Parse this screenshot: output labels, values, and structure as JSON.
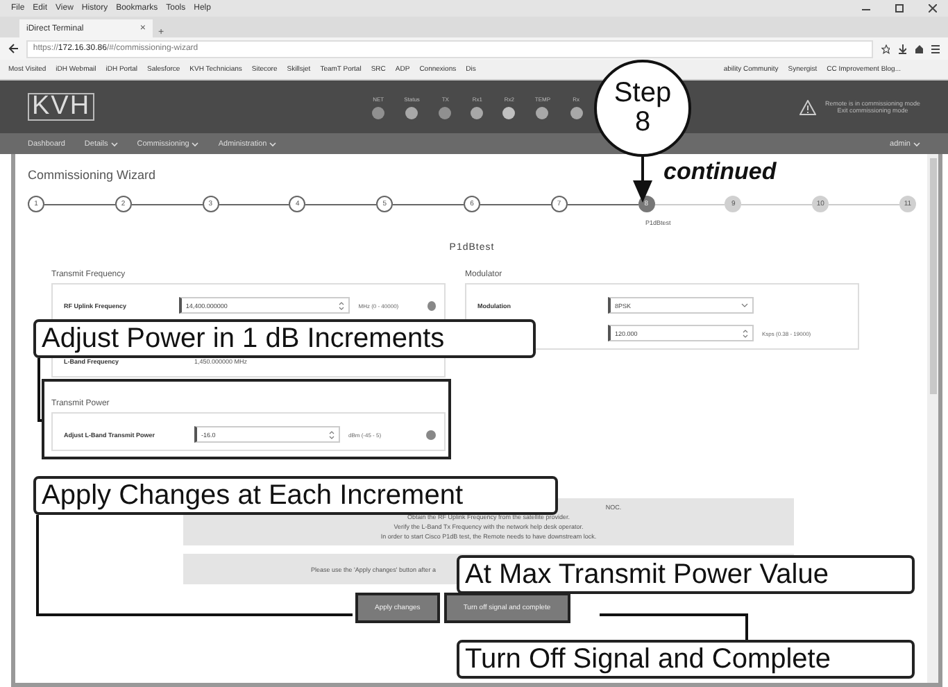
{
  "menu": [
    "File",
    "Edit",
    "View",
    "History",
    "Bookmarks",
    "Tools",
    "Help"
  ],
  "browser_tab": {
    "title": "iDirect Terminal",
    "close": "×",
    "new_tab": "+"
  },
  "address": {
    "prefix": "https://",
    "host": "172.16.30.86",
    "path": "/#/commissioning-wizard"
  },
  "bookmarks_left": [
    "Most Visited",
    "iDH Webmail",
    "iDH Portal",
    "Salesforce",
    "KVH Technicians",
    "Sitecore",
    "Skillsjet",
    "TeamT Portal",
    "SRC",
    "ADP",
    "Connexions",
    "Dis"
  ],
  "bookmarks_right": [
    "ability Community",
    "Synergist",
    "CC Improvement Blog..."
  ],
  "header": {
    "logo": "KVH",
    "indicators": [
      {
        "label": "NET",
        "color": "#909090"
      },
      {
        "label": "Status",
        "color": "#a8a8a8"
      },
      {
        "label": "TX",
        "color": "#909090"
      },
      {
        "label": "Rx1",
        "color": "#a8a8a8"
      },
      {
        "label": "Rx2",
        "color": "#c0c0c0"
      },
      {
        "label": "TEMP",
        "color": "#a8a8a8"
      },
      {
        "label": "Rx",
        "color": "#a8a8a8"
      }
    ],
    "warning": [
      "Remote is in commissioning mode",
      "Exit commissioning mode"
    ]
  },
  "nav": {
    "items": [
      {
        "label": "Dashboard",
        "dropdown": false
      },
      {
        "label": "Details",
        "dropdown": true
      },
      {
        "label": "Commissioning",
        "dropdown": true
      },
      {
        "label": "Administration",
        "dropdown": true
      }
    ],
    "user": "admin"
  },
  "wizard": {
    "title": "Commissioning Wizard",
    "steps": [
      {
        "number": "1",
        "done": true,
        "selected": false
      },
      {
        "number": "2",
        "done": true,
        "selected": false
      },
      {
        "number": "3",
        "done": true,
        "selected": false
      },
      {
        "number": "4",
        "done": true,
        "selected": false
      },
      {
        "number": "5",
        "done": true,
        "selected": false
      },
      {
        "number": "6",
        "done": true,
        "selected": false
      },
      {
        "number": "7",
        "done": true,
        "selected": false
      },
      {
        "number": "8",
        "done": false,
        "selected": true
      },
      {
        "number": "9",
        "done": false,
        "selected": false
      },
      {
        "number": "10",
        "done": false,
        "selected": false
      },
      {
        "number": "11",
        "done": false,
        "selected": false
      }
    ],
    "step_label": "P1dBtest"
  },
  "page_title": "P1dBtest",
  "transmit_frequency": {
    "title": "Transmit Frequency",
    "rows": [
      {
        "label": "RF Uplink Frequency",
        "value": "14,400.000000",
        "unit": "MHz (0 - 40000)"
      },
      {
        "label": "L-Band Frequency",
        "value": "1,450.000000 MHz"
      }
    ]
  },
  "modulator": {
    "title": "Modulator",
    "rows": [
      {
        "label": "Modulation",
        "value": "8PSK",
        "kind": "select"
      },
      {
        "value": "120.000",
        "unit": "Ksps (0.38 - 19000)",
        "kind": "number"
      }
    ]
  },
  "transmit_power": {
    "title": "Transmit Power",
    "label": "Adjust L-Band Transmit Power",
    "value": "-16.0",
    "unit": "dBm (-45 - 5)"
  },
  "notes": [
    "NOC.",
    "Obtain the RF Uplink Frequency from the satellite provider.",
    "Verify the L-Band Tx Frequency with the network help desk operator.",
    "In order to start Cisco P1dB test, the Remote needs to have downstream lock."
  ],
  "apply_note": "Please use the 'Apply changes' button after a",
  "buttons": [
    "Apply changes",
    "Turn off signal and complete"
  ],
  "callouts": {
    "step": [
      "Step",
      "8"
    ],
    "continued": "continued",
    "adjust": "Adjust Power in 1 dB Increments",
    "apply": "Apply Changes at Each Increment",
    "max": "At Max Transmit Power Value",
    "turn_off": "Turn Off Signal and Complete"
  }
}
